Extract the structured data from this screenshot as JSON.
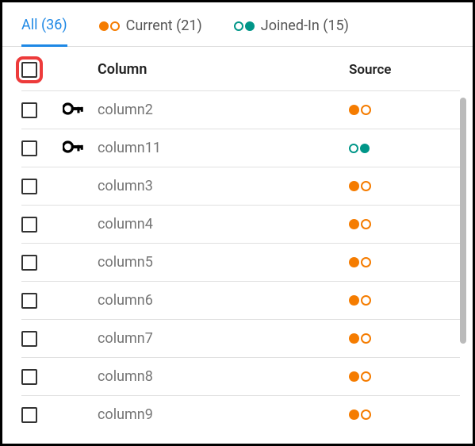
{
  "tabs": {
    "all": {
      "label": "All (36)"
    },
    "current": {
      "label": "Current (21)"
    },
    "joined": {
      "label": "Joined-In (15)"
    }
  },
  "headers": {
    "column": "Column",
    "source": "Source"
  },
  "rows": [
    {
      "name": "column2",
      "key": true,
      "source": "current"
    },
    {
      "name": "column11",
      "key": true,
      "source": "joined"
    },
    {
      "name": "column3",
      "key": false,
      "source": "current"
    },
    {
      "name": "column4",
      "key": false,
      "source": "current"
    },
    {
      "name": "column5",
      "key": false,
      "source": "current"
    },
    {
      "name": "column6",
      "key": false,
      "source": "current"
    },
    {
      "name": "column7",
      "key": false,
      "source": "current"
    },
    {
      "name": "column8",
      "key": false,
      "source": "current"
    },
    {
      "name": "column9",
      "key": false,
      "source": "current"
    }
  ],
  "colors": {
    "accent": "#1e88e5",
    "orange": "#f57c00",
    "teal": "#009688"
  }
}
